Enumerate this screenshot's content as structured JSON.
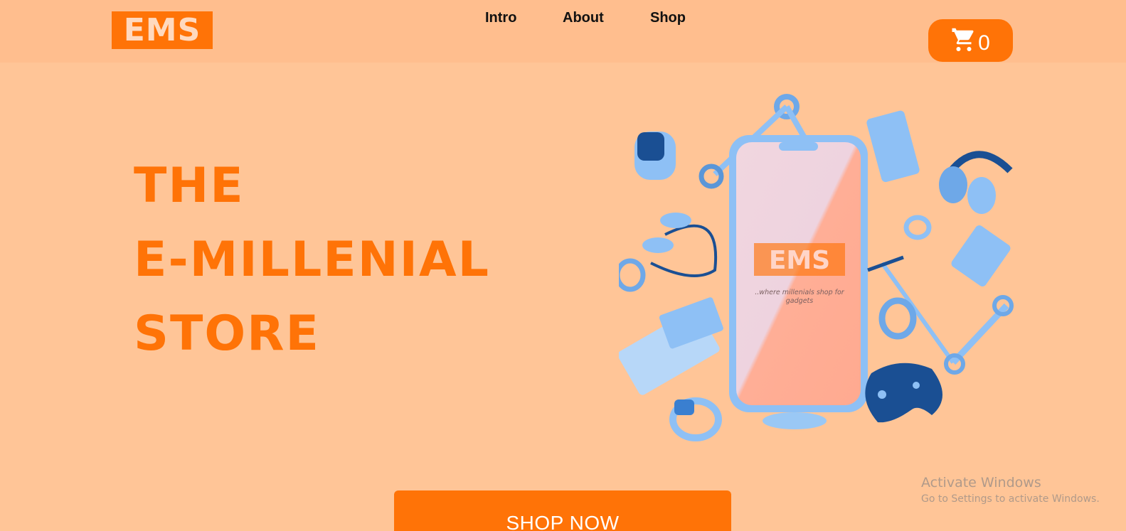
{
  "header": {
    "logo": "EMS",
    "nav": [
      {
        "label": "Intro"
      },
      {
        "label": "About"
      },
      {
        "label": "Shop"
      }
    ],
    "cart": {
      "icon": "cart-icon",
      "count": "0"
    }
  },
  "hero": {
    "lines": [
      "THE",
      "E-MILLENIAL",
      "STORE"
    ],
    "phone_logo": "EMS",
    "phone_tagline_1": "..where millenials shop for",
    "phone_tagline_2": "gadgets",
    "cta": "SHOP NOW"
  },
  "watermark": {
    "title": "Activate Windows",
    "subtitle": "Go to Settings to activate Windows."
  },
  "colors": {
    "accent": "#ff7307",
    "background": "#ffc597",
    "header_background": "#ffbe8e",
    "gadget_blue": "#8ec0f5"
  }
}
